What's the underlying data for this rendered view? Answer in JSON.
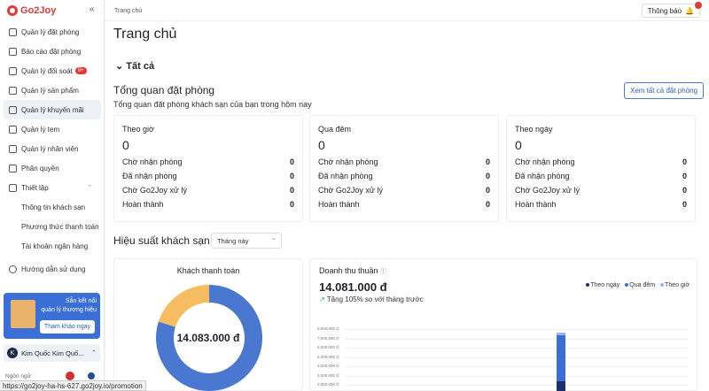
{
  "app": {
    "logo": "Go2Joy",
    "collapse": "«"
  },
  "nav": [
    {
      "label": "Quản lý đặt phòng"
    },
    {
      "label": "Báo cáo đặt phòng"
    },
    {
      "label": "Quản lý đối soát",
      "badge": "9+"
    },
    {
      "label": "Quản lý sản phẩm"
    },
    {
      "label": "Quản lý khuyến mãi",
      "active": true
    },
    {
      "label": "Quản lý tem"
    },
    {
      "label": "Quản lý nhân viên"
    },
    {
      "label": "Phân quyền"
    },
    {
      "label": "Thiết lập",
      "expanded": true
    }
  ],
  "subnav": [
    "Thông tin khách sạn",
    "Phương thức thanh toán",
    "Tài khoản ngân hàng"
  ],
  "guide": "Hướng dẫn sử dụng",
  "promo": {
    "line1": "Sẵn kết nối",
    "line2": "quản lý thương hiệu",
    "button": "Tham khảo ngay"
  },
  "user": {
    "initial": "K",
    "name": "Kim Quốc Kim Quố..."
  },
  "lang_label": "Ngôn ngữ",
  "status_url": "https://go2joy-ha-hs-627.go2joy.io/promotion",
  "breadcrumb": "Trang chủ",
  "notif_label": "Thông báo",
  "page_title": "Trang chủ",
  "section_all": "Tất cả",
  "overview": {
    "title": "Tổng quan đặt phòng",
    "subtitle": "Tổng quan đặt phòng khách sạn của bạn trong hôm nay",
    "view_all": "Xem tất cả đặt phòng"
  },
  "cards": [
    {
      "title": "Theo giờ",
      "total": "0",
      "rows": [
        [
          "Chờ nhận phòng",
          "0"
        ],
        [
          "Đã nhận phòng",
          "0"
        ],
        [
          "Chờ Go2Joy xử lý",
          "0"
        ],
        [
          "Hoàn thành",
          "0"
        ]
      ]
    },
    {
      "title": "Qua đêm",
      "total": "0",
      "rows": [
        [
          "Chờ nhận phòng",
          "0"
        ],
        [
          "Đã nhận phòng",
          "0"
        ],
        [
          "Chờ Go2Joy xử lý",
          "0"
        ],
        [
          "Hoàn thành",
          "0"
        ]
      ]
    },
    {
      "title": "Theo ngày",
      "total": "0",
      "rows": [
        [
          "Chờ nhận phòng",
          "0"
        ],
        [
          "Đã nhận phòng",
          "0"
        ],
        [
          "Chờ Go2Joy xử lý",
          "0"
        ],
        [
          "Hoàn thành",
          "0"
        ]
      ]
    }
  ],
  "perf": {
    "title": "Hiệu suất khách sạn",
    "range": "Tháng này"
  },
  "donut": {
    "title": "Khách thanh toán",
    "center": "14.083.000 đ"
  },
  "revenue": {
    "title": "Doanh thu thuần",
    "value": "14.081.000 đ",
    "change": "Tăng 105% so với tháng trước"
  },
  "chart_data": [
    {
      "type": "pie",
      "title": "Khách thanh toán",
      "slices": [
        {
          "share": 0.8,
          "color": "#4a78d1"
        },
        {
          "share": 0.2,
          "color": "#f6bd60"
        }
      ]
    },
    {
      "type": "bar",
      "title": "Doanh thu thuần",
      "yticks": [
        "8,000,000 đ",
        "7,000,000 đ",
        "6,000,000 đ",
        "5,000,000 đ",
        "4,000,000 đ",
        "3,000,000 đ",
        "2,000,000 đ"
      ],
      "ylim": [
        0,
        8000000
      ],
      "series": [
        {
          "name": "Theo ngày",
          "color": "#1c2f6e",
          "values": [
            2400000
          ]
        },
        {
          "name": "Qua đêm",
          "color": "#3c6fd0",
          "values": [
            4900000
          ]
        },
        {
          "name": "Theo giờ",
          "color": "#9ab5e8",
          "values": [
            300000
          ]
        }
      ]
    }
  ]
}
